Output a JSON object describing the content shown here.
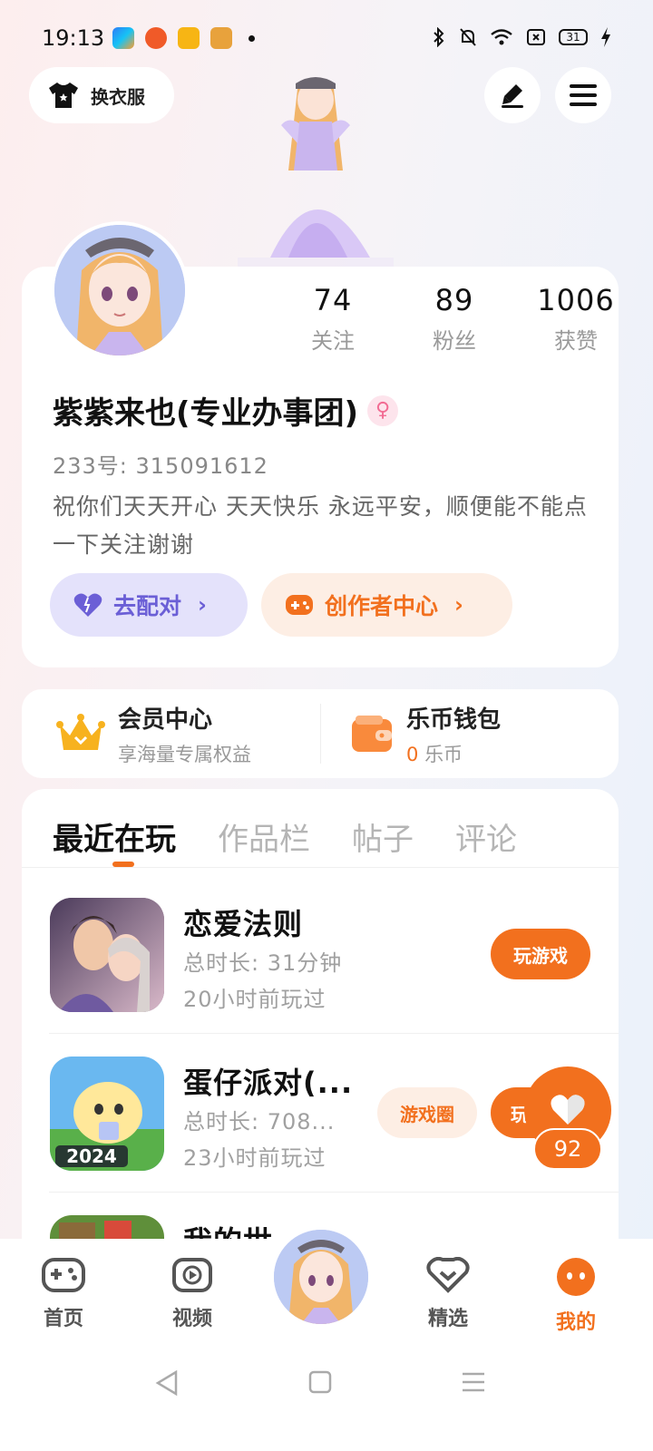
{
  "status_bar": {
    "time": "19:13",
    "battery": "31",
    "icons": [
      "bluetooth-icon",
      "mute-icon",
      "wifi-icon",
      "nfc-icon",
      "battery-icon",
      "charging-icon"
    ]
  },
  "top": {
    "outfit_label": "换衣服"
  },
  "profile": {
    "stats": [
      {
        "value": "74",
        "label": "关注"
      },
      {
        "value": "89",
        "label": "粉丝"
      },
      {
        "value": "1006",
        "label": "获赞"
      }
    ],
    "username": "紫紫来也(专业办事团)",
    "gender_symbol": "♀",
    "uid": "233号: 315091612",
    "bio": "祝你们天天开心 天天快乐 永远平安，顺便能不能点一下关注谢谢",
    "match_label": "去配对",
    "creator_label": "创作者中心"
  },
  "vip": {
    "title": "会员中心",
    "subtitle": "享海量专属权益"
  },
  "wallet": {
    "title": "乐币钱包",
    "amount": "0",
    "unit": "乐币"
  },
  "tabs": [
    "最近在玩",
    "作品栏",
    "帖子",
    "评论"
  ],
  "games": [
    {
      "name": "恋爱法则",
      "duration": "总时长: 31分钟",
      "last_played": "20小时前玩过",
      "play_label": "玩游戏"
    },
    {
      "name": "蛋仔派对(...",
      "duration": "总时长: 708...",
      "last_played": "23小时前玩过",
      "circle_label": "游戏圈",
      "play_label": "玩"
    },
    {
      "name": "我的世"
    }
  ],
  "float_like": {
    "count": "92"
  },
  "bottom_nav": [
    {
      "label": "首页"
    },
    {
      "label": "视频"
    },
    {
      "label": "精选"
    },
    {
      "label": "我的"
    }
  ],
  "colors": {
    "accent": "#f2701e",
    "match": "#6b5fd6"
  }
}
